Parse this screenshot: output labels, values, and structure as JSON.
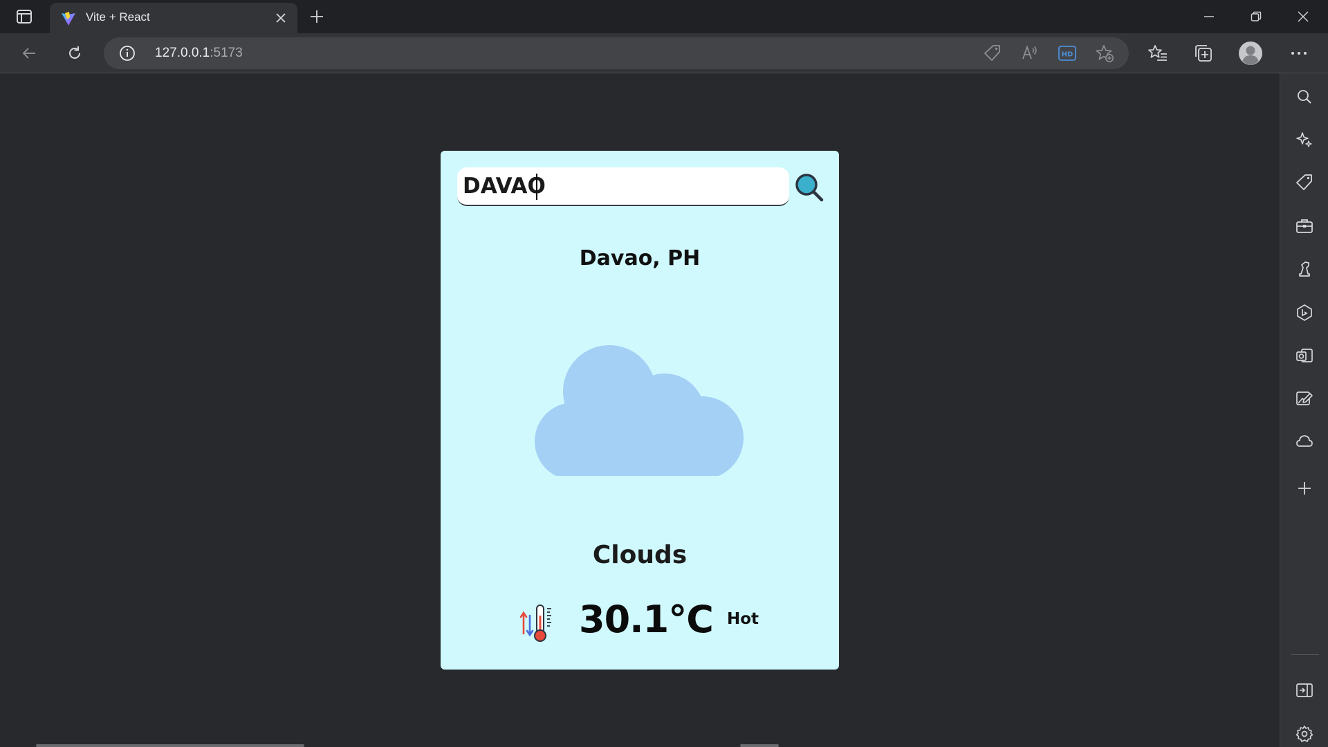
{
  "browser": {
    "tab": {
      "title": "Vite + React"
    },
    "address": {
      "host": "127.0.0.1",
      "port": ":5173"
    }
  },
  "weather": {
    "search_value": "DAVAO",
    "city": "Davao, PH",
    "condition": "Clouds",
    "temperature": "30.1°C",
    "feel": "Hot"
  },
  "icons": {
    "card_bg": "#cff9fd",
    "cloud_color": "#a4d0f6",
    "search_icon_color": "#3ab0cd"
  }
}
